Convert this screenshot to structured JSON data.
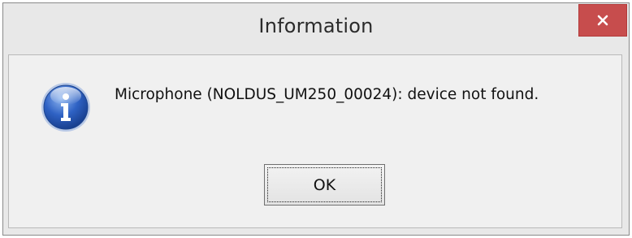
{
  "dialog": {
    "title": "Information",
    "message": "Microphone (NOLDUS_UM250_00024): device not found.",
    "ok_label": "OK",
    "icon": "info-icon",
    "close_icon": "close-icon"
  },
  "colors": {
    "window_background": "#e8e8e8",
    "content_background": "#f0f0f0",
    "close_button": "#c74d4d",
    "info_icon_blue": "#2a5db8"
  }
}
